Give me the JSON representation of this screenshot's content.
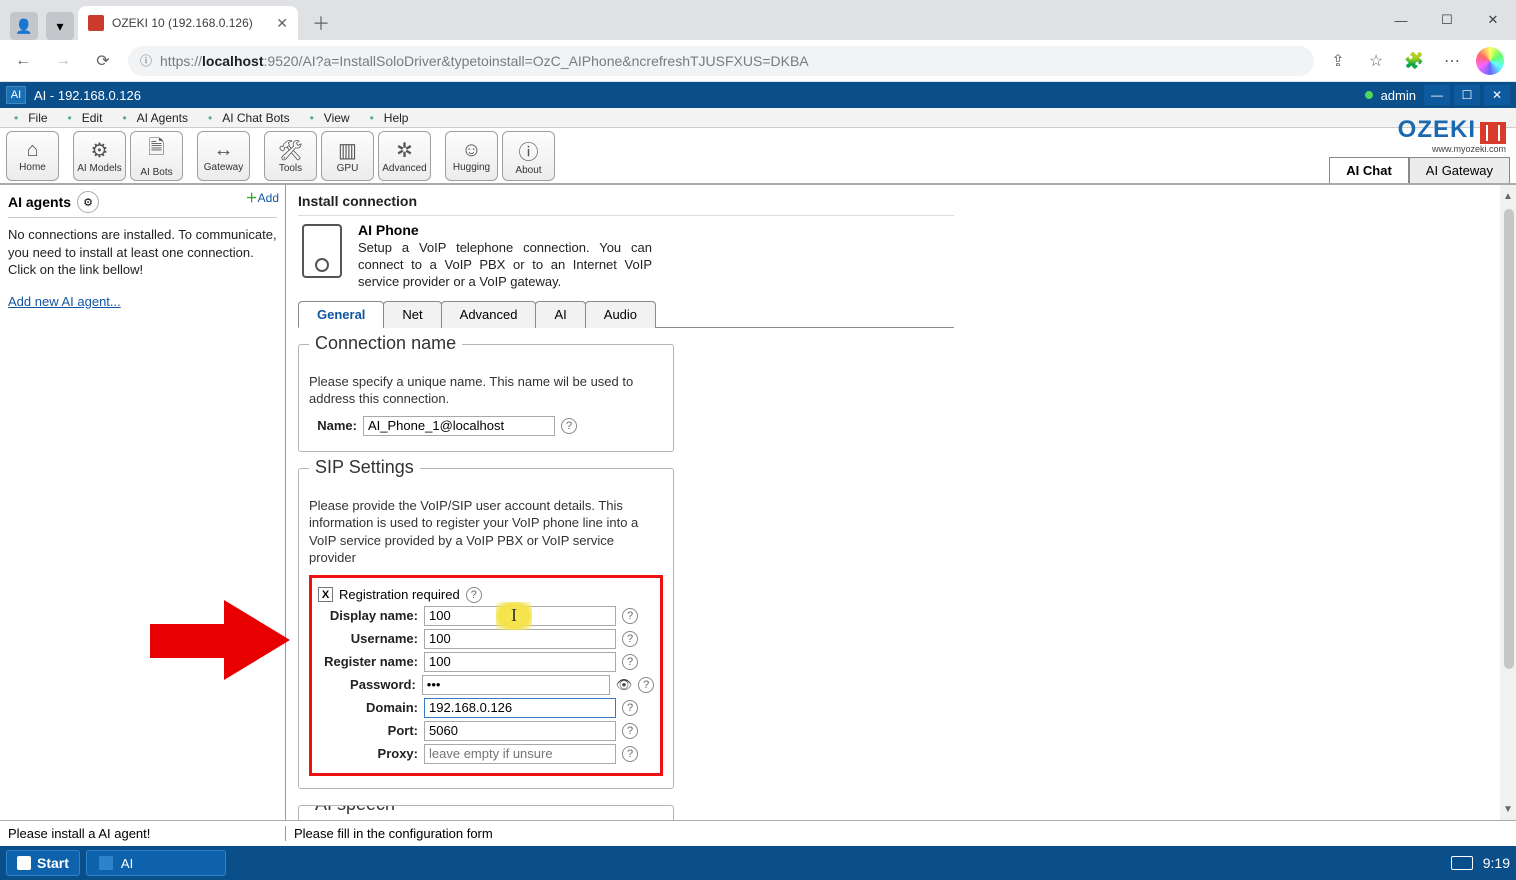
{
  "browser": {
    "tab_title": "OZEKI 10 (192.168.0.126)",
    "url_pre": "https://",
    "url_host": "localhost",
    "url_rest": ":9520/AI?a=InstallSoloDriver&typetoinstall=OzC_AIPhone&ncrefreshTJUSFXUS=DKBA"
  },
  "ozeki": {
    "title": "AI - 192.168.0.126",
    "user": "admin",
    "menus": [
      "File",
      "Edit",
      "AI Agents",
      "AI Chat Bots",
      "View",
      "Help"
    ],
    "toolbar": [
      {
        "label": "Home",
        "icon": "⌂"
      },
      {
        "label": "AI Models",
        "icon": "⚙"
      },
      {
        "label": "AI Bots",
        "icon": "🗎"
      },
      {
        "label": "Gateway",
        "icon": "↔"
      },
      {
        "label": "Tools",
        "icon": "🛠"
      },
      {
        "label": "GPU",
        "icon": "▥"
      },
      {
        "label": "Advanced",
        "icon": "✲"
      },
      {
        "label": "Hugging",
        "icon": "☺"
      },
      {
        "label": "About",
        "icon": "ⓘ"
      }
    ],
    "right_tabs": [
      "AI Chat",
      "AI Gateway"
    ],
    "right_tab_active": "AI Chat",
    "logo_main": "OZEKI",
    "logo_sub": "www.myozeki.com"
  },
  "left": {
    "heading": "AI agents",
    "add": "Add",
    "body": "No connections are installed. To communicate, you need to install at least one connection. Click on the link bellow!",
    "link": "Add new AI agent..."
  },
  "right": {
    "heading": "Install connection",
    "hero_title": "AI Phone",
    "hero_desc": "Setup a VoIP telephone connection. You can connect to a VoIP PBX or to an Internet VoIP service provider or a VoIP gateway.",
    "tabs": [
      "General",
      "Net",
      "Advanced",
      "AI",
      "Audio"
    ],
    "tab_active": "General",
    "sec1_title": "Connection name",
    "sec1_desc": "Please specify a unique name. This name wil be used to address this connection.",
    "sec1_label": "Name:",
    "sec1_value": "AI_Phone_1@localhost",
    "sec2_title": "SIP Settings",
    "sec2_desc": "Please provide the VoIP/SIP user account details. This information is used to register your VoIP phone line into a VoIP service provided by a VoIP PBX or VoIP service provider",
    "reg_chk": "X",
    "reg_label": "Registration required",
    "rows": [
      {
        "label": "Display name:",
        "value": "100"
      },
      {
        "label": "Username:",
        "value": "100"
      },
      {
        "label": "Register name:",
        "value": "100"
      },
      {
        "label": "Password:",
        "value": "•••",
        "type": "password"
      },
      {
        "label": "Domain:",
        "value": "192.168.0.126"
      },
      {
        "label": "Port:",
        "value": "5060"
      },
      {
        "label": "Proxy:",
        "value": "",
        "placeholder": "leave empty if unsure"
      }
    ],
    "sec3_title": "AI speech"
  },
  "statusbar": {
    "left": "Please install a AI agent!",
    "right": "Please fill in the configuration form"
  },
  "taskbar": {
    "start": "Start",
    "task1": "AI",
    "clock": "9:19"
  }
}
